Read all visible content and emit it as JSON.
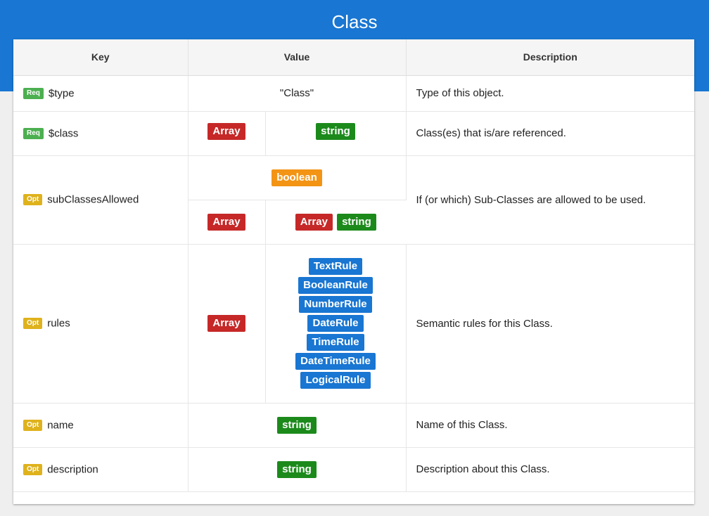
{
  "page": {
    "title": "Class"
  },
  "headers": {
    "key": "Key",
    "value": "Value",
    "description": "Description"
  },
  "badges": {
    "req": "Req",
    "opt": "Opt"
  },
  "rows": {
    "type": {
      "badge": "Req",
      "key": "$type",
      "value": "\"Class\"",
      "description": "Type of this object."
    },
    "class": {
      "badge": "Req",
      "key": "$class",
      "container": "Array",
      "item": "string",
      "description": "Class(es) that is/are referenced."
    },
    "subClassesAllowed": {
      "badge": "Opt",
      "key": "subClassesAllowed",
      "option1": "boolean",
      "option2_container": "Array",
      "option2_items": [
        "Array",
        "string"
      ],
      "description": "If (or which) Sub-Classes are allowed to be used."
    },
    "rules": {
      "badge": "Opt",
      "key": "rules",
      "container": "Array",
      "items": [
        "TextRule",
        "BooleanRule",
        "NumberRule",
        "DateRule",
        "TimeRule",
        "DateTimeRule",
        "LogicalRule"
      ],
      "description": "Semantic rules for this Class."
    },
    "name": {
      "badge": "Opt",
      "key": "name",
      "value": "string",
      "description": "Name of this Class."
    },
    "description": {
      "badge": "Opt",
      "key": "description",
      "value": "string",
      "description": "Description about this Class."
    }
  },
  "colors": {
    "header_blue": "#1976d2",
    "array_red": "#c62828",
    "string_green": "#1b8a1b",
    "boolean_orange": "#f39414",
    "rule_blue": "#1976d2",
    "req_green": "#4caf50",
    "opt_yellow": "#dfb21c"
  }
}
